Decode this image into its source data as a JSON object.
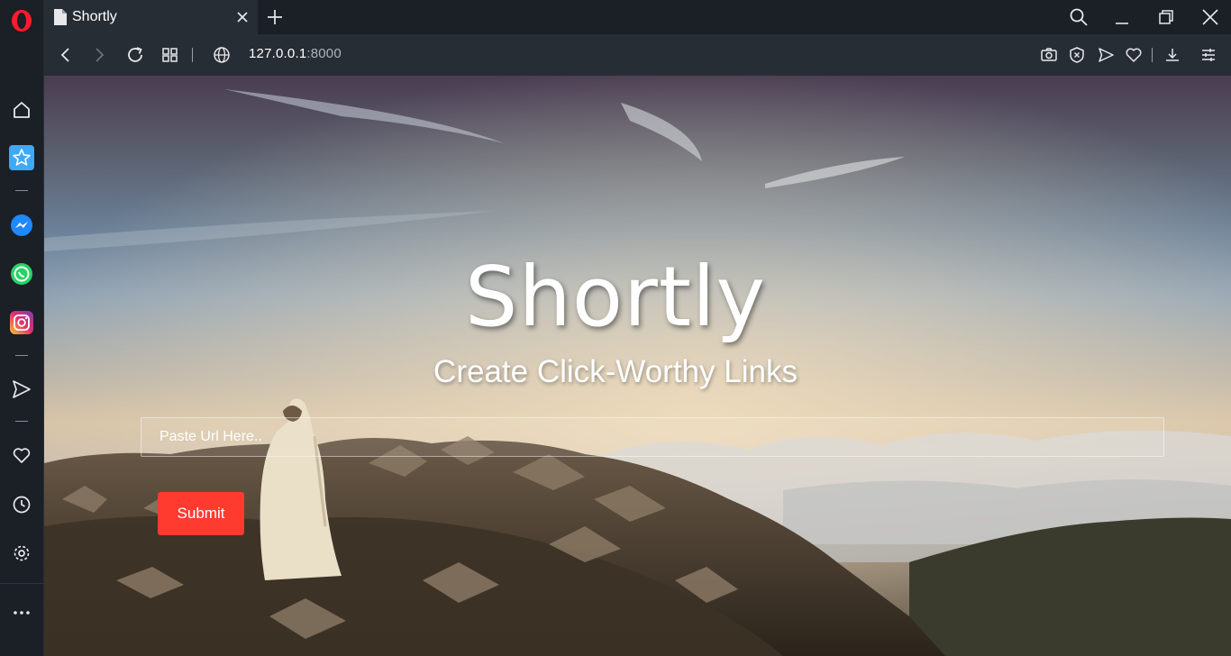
{
  "browser": {
    "tab": {
      "title": "Shortly"
    },
    "address": {
      "host": "127.0.0.1",
      "port": ":8000"
    }
  },
  "sidebar": {
    "items": [
      "home-icon",
      "speed-dial-icon",
      "messenger-icon",
      "whatsapp-icon",
      "instagram-icon",
      "flow-icon",
      "heart-icon",
      "history-icon",
      "settings-icon",
      "more-icon"
    ]
  },
  "page": {
    "headline": "Shortly",
    "tagline": "Create Click-Worthy Links",
    "input": {
      "placeholder": "Paste Url Here..",
      "value": ""
    },
    "submit_label": "Submit"
  },
  "colors": {
    "browser_dark": "#1b1f26",
    "toolbar": "#272d35",
    "opera_red": "#ff1b2d",
    "submit": "#ff3b30"
  }
}
